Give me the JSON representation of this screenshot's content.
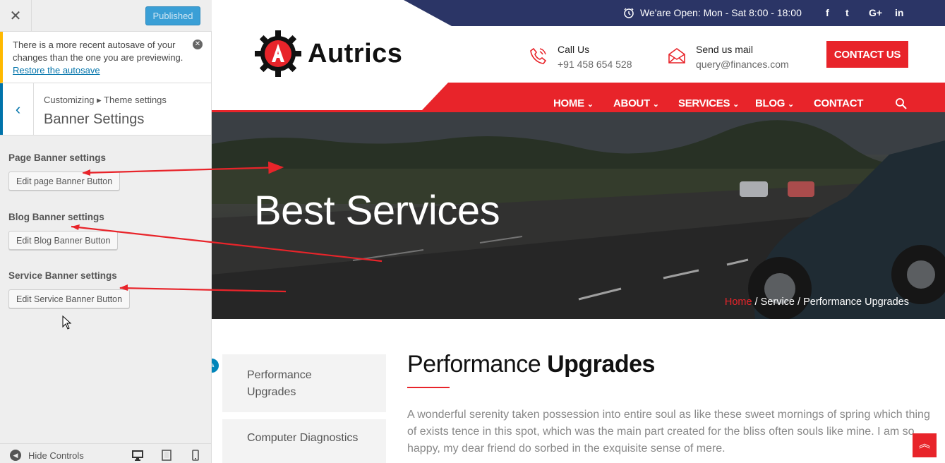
{
  "customizer": {
    "close_icon": "close-icon",
    "publish_label": "Published",
    "notice": {
      "text": "There is a more recent autosave of your changes than the one you are previewing.",
      "link": "Restore the autosave"
    },
    "breadcrumb": "Customizing ▸ Theme settings",
    "section_title": "Banner Settings",
    "groups": [
      {
        "label": "Page Banner settings",
        "button": "Edit page Banner Button"
      },
      {
        "label": "Blog Banner settings",
        "button": "Edit Blog Banner Button"
      },
      {
        "label": "Service Banner settings",
        "button": "Edit Service Banner Button"
      }
    ],
    "footer": {
      "hide_label": "Hide Controls"
    }
  },
  "site": {
    "open_hours": "We'are Open: Mon - Sat 8:00 - 18:00",
    "social": [
      "f",
      "t",
      "G+",
      "in"
    ],
    "logo": "Autrics",
    "call": {
      "title": "Call Us",
      "value": "+91 458 654 528"
    },
    "mail": {
      "title": "Send us mail",
      "value": "query@finances.com"
    },
    "contact_button": "CONTACT US",
    "nav": [
      "HOME",
      "ABOUT",
      "SERVICES",
      "BLOG",
      "CONTACT"
    ],
    "banner_title": "Best Services",
    "crumb": {
      "home": "Home",
      "sep": " / ",
      "service": "Service",
      "current": "Performance Upgrades"
    },
    "sidebar": [
      "Performance Upgrades",
      "Computer Diagnostics"
    ],
    "content_title_light": "Performance ",
    "content_title_bold": "Upgrades",
    "content_body": "A wonderful serenity taken possession into entire soul as like these sweet mornings of spring which thing of exists tence in this spot, which was the main part created for the bliss often souls like mine. I am so happy, my dear friend do sorbed in the exquisite sense of mere."
  },
  "colors": {
    "accent": "#e8242a",
    "topbar": "#2b3566",
    "wp_blue": "#0073aa"
  }
}
